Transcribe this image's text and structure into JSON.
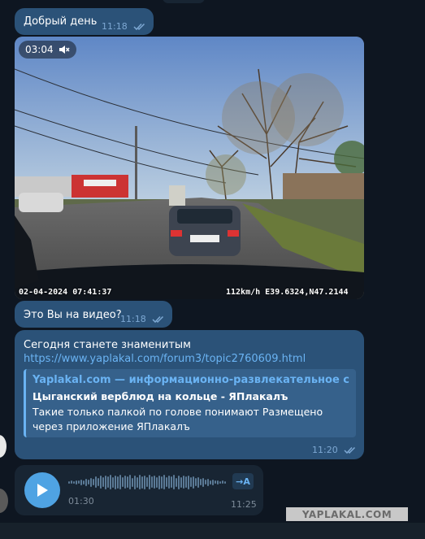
{
  "messages": {
    "greeting": {
      "text": "Добрый день",
      "time": "11:18"
    },
    "video": {
      "duration": "03:04",
      "osd_datetime": "02-04-2024 07:41:37",
      "osd_gps": "112km/h E39.6324,N47.2144"
    },
    "question": {
      "text": "Это Вы на видео?",
      "time": "11:18"
    },
    "link_message": {
      "text": "Сегодня станете знаменитым",
      "url": "https://www.yaplakal.com/forum3/topic2760609.html",
      "time": "11:20",
      "preview": {
        "site": "Yaplakal.com — информационно-развлекательное сообщ...",
        "title": "Цыганский верблюд на кольце - ЯПлакалъ",
        "description": "Такие только палкой по голове понимают    Размещено через приложение ЯПлакалъ"
      }
    },
    "voice": {
      "duration": "01:30",
      "time": "11:25",
      "transcribe_label": "→A"
    }
  },
  "watermark": "YAPLAKAL.COM",
  "colors": {
    "bubble": "#2b5278",
    "background": "#0e1621",
    "accent": "#6ab3f3"
  }
}
